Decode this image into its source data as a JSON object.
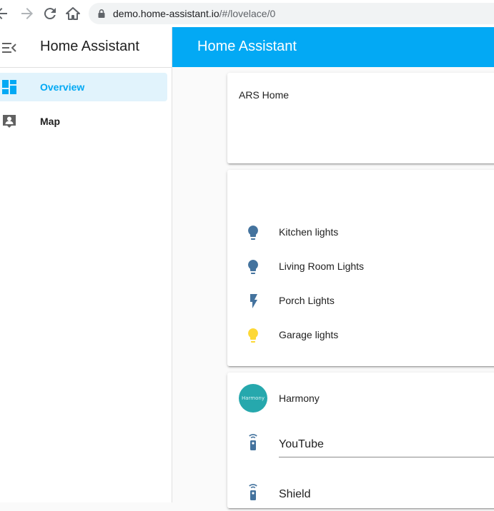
{
  "browser": {
    "url_host": "demo.home-assistant.io",
    "url_path": "/#/lovelace/0"
  },
  "sidebar": {
    "title": "Home Assistant",
    "items": [
      {
        "label": "Overview",
        "icon": "view-dashboard-icon",
        "active": true
      },
      {
        "label": "Map",
        "icon": "account-box-icon",
        "active": false
      }
    ]
  },
  "header": {
    "title": "Home Assistant"
  },
  "cards": {
    "home": {
      "title": "ARS Home"
    },
    "lights": {
      "entities": [
        {
          "label": "Kitchen lights",
          "icon": "lightbulb-icon",
          "color": "#44739e"
        },
        {
          "label": "Living Room Lights",
          "icon": "lightbulb-icon",
          "color": "#44739e"
        },
        {
          "label": "Porch Lights",
          "icon": "flash-icon",
          "color": "#44739e"
        },
        {
          "label": "Garage lights",
          "icon": "lightbulb-icon",
          "color": "#fdd835"
        }
      ]
    },
    "harmony": {
      "logo_text": "Harmony",
      "name": "Harmony",
      "activities": [
        {
          "label": "YouTube",
          "icon": "remote-icon"
        },
        {
          "label": "Shield",
          "icon": "remote-icon"
        }
      ]
    }
  },
  "colors": {
    "accent": "#03a9f4",
    "icon_off": "#44739e",
    "icon_on": "#fdd835"
  }
}
